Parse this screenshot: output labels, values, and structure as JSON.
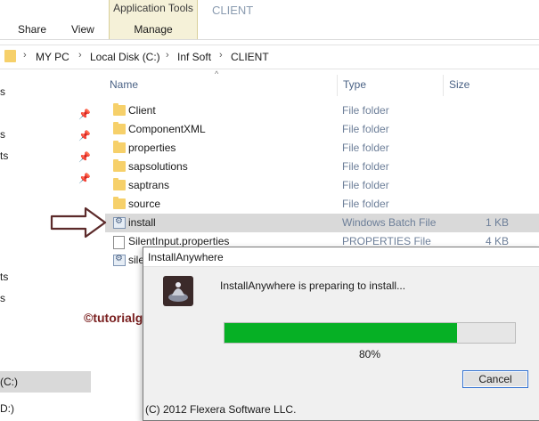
{
  "ribbon": {
    "tabs": [
      "Share",
      "View"
    ],
    "contextual_group": "Application Tools",
    "contextual_tab": "Manage",
    "window_title": "CLIENT"
  },
  "address_bar": {
    "crumbs": [
      "MY PC",
      "Local Disk (C:)",
      "Inf Soft",
      "CLIENT"
    ]
  },
  "nav_pane": {
    "fragments": [
      "s",
      "s",
      "ts",
      "ts",
      "s",
      "(C:)",
      "D:)"
    ],
    "selected": "(C:)"
  },
  "columns": {
    "name": "Name",
    "type": "Type",
    "size": "Size"
  },
  "files": [
    {
      "name": "Client",
      "type": "File folder",
      "size": "",
      "icon": "folder-icon"
    },
    {
      "name": "ComponentXML",
      "type": "File folder",
      "size": "",
      "icon": "folder-icon"
    },
    {
      "name": "properties",
      "type": "File folder",
      "size": "",
      "icon": "folder-icon"
    },
    {
      "name": "sapsolutions",
      "type": "File folder",
      "size": "",
      "icon": "folder-icon"
    },
    {
      "name": "saptrans",
      "type": "File folder",
      "size": "",
      "icon": "folder-icon"
    },
    {
      "name": "source",
      "type": "File folder",
      "size": "",
      "icon": "folder-icon"
    },
    {
      "name": "install",
      "type": "Windows Batch File",
      "size": "1 KB",
      "icon": "batch-file-icon",
      "highlighted": true
    },
    {
      "name": "SilentInput.properties",
      "type": "PROPERTIES File",
      "size": "4 KB",
      "icon": "file-icon"
    },
    {
      "name": "sile",
      "type": "",
      "size": "",
      "icon": "batch-file-icon"
    }
  ],
  "dialog": {
    "title": "InstallAnywhere",
    "message": "InstallAnywhere is preparing to install...",
    "progress": 0.8,
    "progress_label": "80%",
    "cancel_label": "Cancel",
    "copyright": "(C) 2012 Flexera Software LLC."
  },
  "watermark": "©tutorialgateway.org",
  "colors": {
    "progress_fill": "#06b025",
    "context_tab_bg": "#f5f1d8",
    "row_highlight": "#d9d9d9",
    "watermark": "#7a2020",
    "arrow": "#5c2a2a"
  }
}
